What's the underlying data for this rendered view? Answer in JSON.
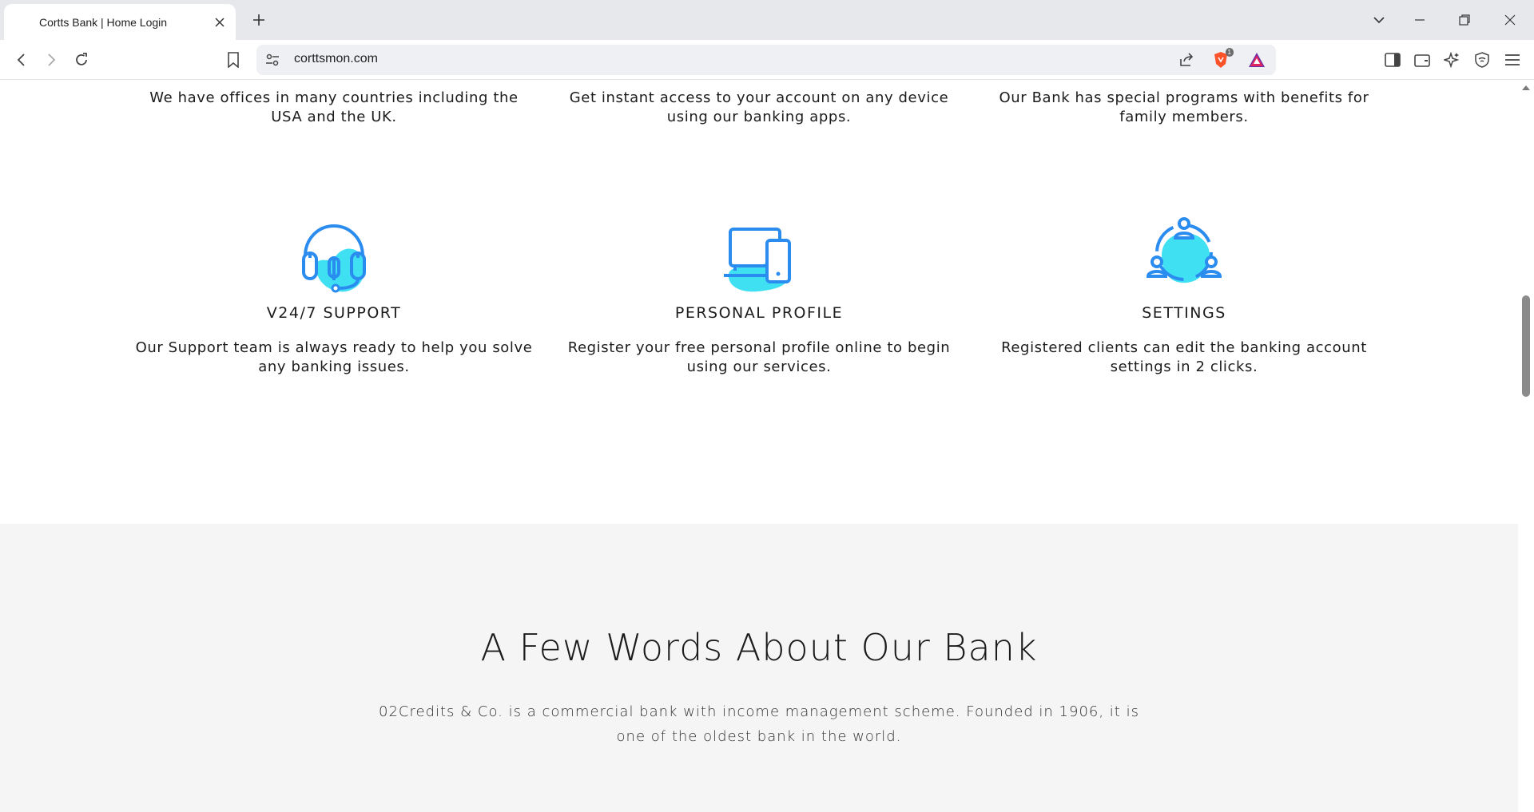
{
  "browser": {
    "tab_title": "Cortts Bank | Home Login",
    "url": "corttsmon.com",
    "shield_badge": "1"
  },
  "features_top": [
    {
      "text": "We have offices in many countries including the USA and the UK."
    },
    {
      "text": "Get instant access to your account on any device using our banking apps."
    },
    {
      "text": "Our Bank has special programs with benefits for family members."
    }
  ],
  "features": [
    {
      "icon": "headset-icon",
      "title": "V24/7 SUPPORT",
      "text": "Our Support team is always ready to help you solve any banking issues."
    },
    {
      "icon": "devices-icon",
      "title": "PERSONAL PROFILE",
      "text": "Register your free personal profile online to begin using our services."
    },
    {
      "icon": "users-network-icon",
      "title": "SETTINGS",
      "text": "Registered clients can edit the banking account settings in 2 clicks."
    }
  ],
  "about": {
    "title": "A Few Words About Our Bank",
    "text": "02Credits & Co. is a commercial bank with income management scheme. Founded in 1906, it is one of the oldest bank in the world."
  },
  "colors": {
    "accent_blue": "#2b8cf0",
    "accent_cyan": "#3fe0f2",
    "section_bg": "#f5f5f5"
  }
}
